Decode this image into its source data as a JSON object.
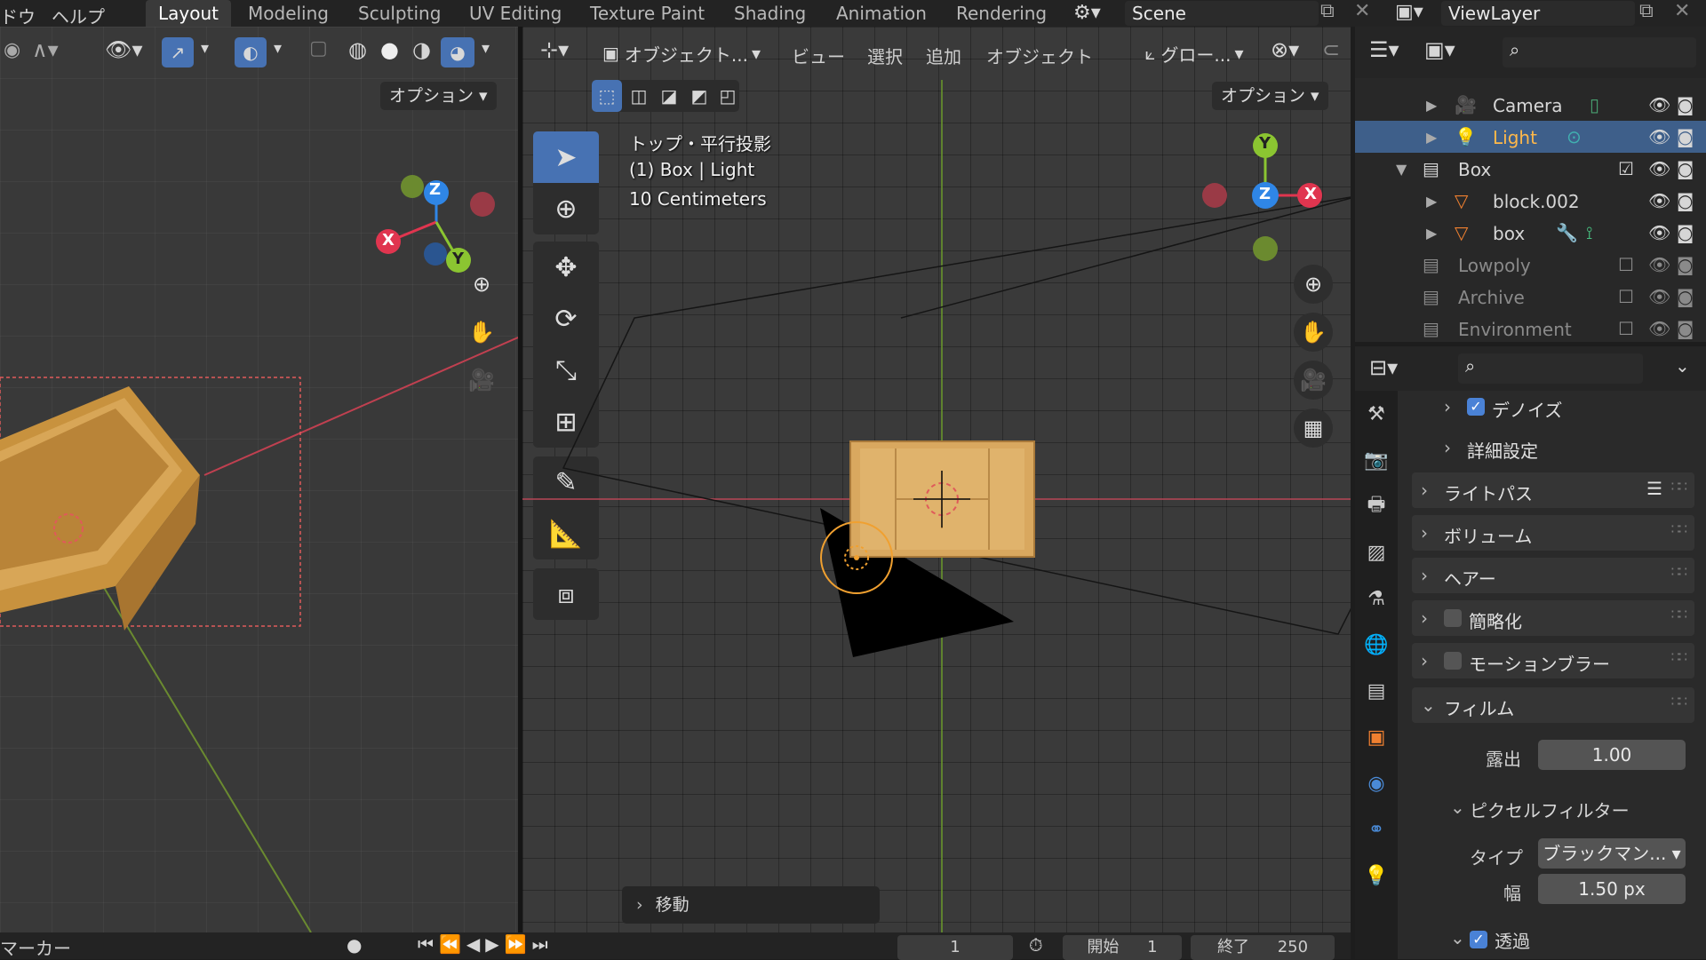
{
  "topbar": {
    "menus": [
      "ドウ",
      "ヘルプ"
    ],
    "workspaces": [
      "Layout",
      "Modeling",
      "Sculpting",
      "UV Editing",
      "Texture Paint",
      "Shading",
      "Animation",
      "Rendering"
    ],
    "active_workspace": "Layout",
    "scene_name": "Scene",
    "view_layer": "ViewLayer"
  },
  "left_viewport": {
    "options_label": "オプション"
  },
  "main_viewport": {
    "mode_label": "オブジェクト...",
    "menu": [
      "ビュー",
      "選択",
      "追加",
      "オブジェクト"
    ],
    "transform_orientation": "グロー...",
    "options_label": "オプション",
    "overlay": {
      "view_name": "トップ・平行投影",
      "object_info": "(1) Box | Light",
      "scale": "10 Centimeters"
    },
    "last_operator": "移動",
    "gizmo_axes": {
      "y": "Y",
      "z": "Z",
      "x": "X"
    }
  },
  "left_gizmo_axes": {
    "x": "X",
    "y": "Y",
    "z": "Z"
  },
  "outliner": {
    "rows": [
      {
        "label": "Camera",
        "icon": "camera-icon",
        "selected": false,
        "dim": false
      },
      {
        "label": "Light",
        "icon": "light-icon",
        "selected": true,
        "dim": false
      },
      {
        "label": "Box",
        "icon": "collection-icon",
        "selected": false,
        "dim": false
      },
      {
        "label": "block.002",
        "icon": "mesh-icon",
        "selected": false,
        "dim": false
      },
      {
        "label": "box",
        "icon": "mesh-icon",
        "selected": false,
        "dim": false
      },
      {
        "label": "Lowpoly",
        "icon": "collection-icon",
        "selected": false,
        "dim": true
      },
      {
        "label": "Archive",
        "icon": "collection-icon",
        "selected": false,
        "dim": true
      },
      {
        "label": "Environment",
        "icon": "collection-icon",
        "selected": false,
        "dim": true
      }
    ]
  },
  "properties": {
    "panels": {
      "denoise": "デノイズ",
      "advanced": "詳細設定",
      "light_paths": "ライトパス",
      "volumes": "ボリューム",
      "hair": "ヘアー",
      "simplify": "簡略化",
      "motion_blur": "モーションブラー",
      "film": "フィルム",
      "pixel_filter": "ピクセルフィルター",
      "transparent": "透過"
    },
    "exposure_label": "露出",
    "exposure_value": "1.00",
    "filter_type_label": "タイプ",
    "filter_type_value": "ブラックマン...",
    "filter_width_label": "幅",
    "filter_width_value": "1.50 px"
  },
  "timeline": {
    "marker_label": "マーカー",
    "current_frame": "1",
    "start_label": "開始",
    "start_value": "1",
    "end_label": "終了",
    "end_value": "250"
  },
  "colors": {
    "accent": "#4772b3",
    "selected_row": "#3e5f8a",
    "axis_x": "#e0354f",
    "axis_y": "#8bc531",
    "axis_z": "#2f86e6",
    "light_orange": "#f0a030"
  }
}
